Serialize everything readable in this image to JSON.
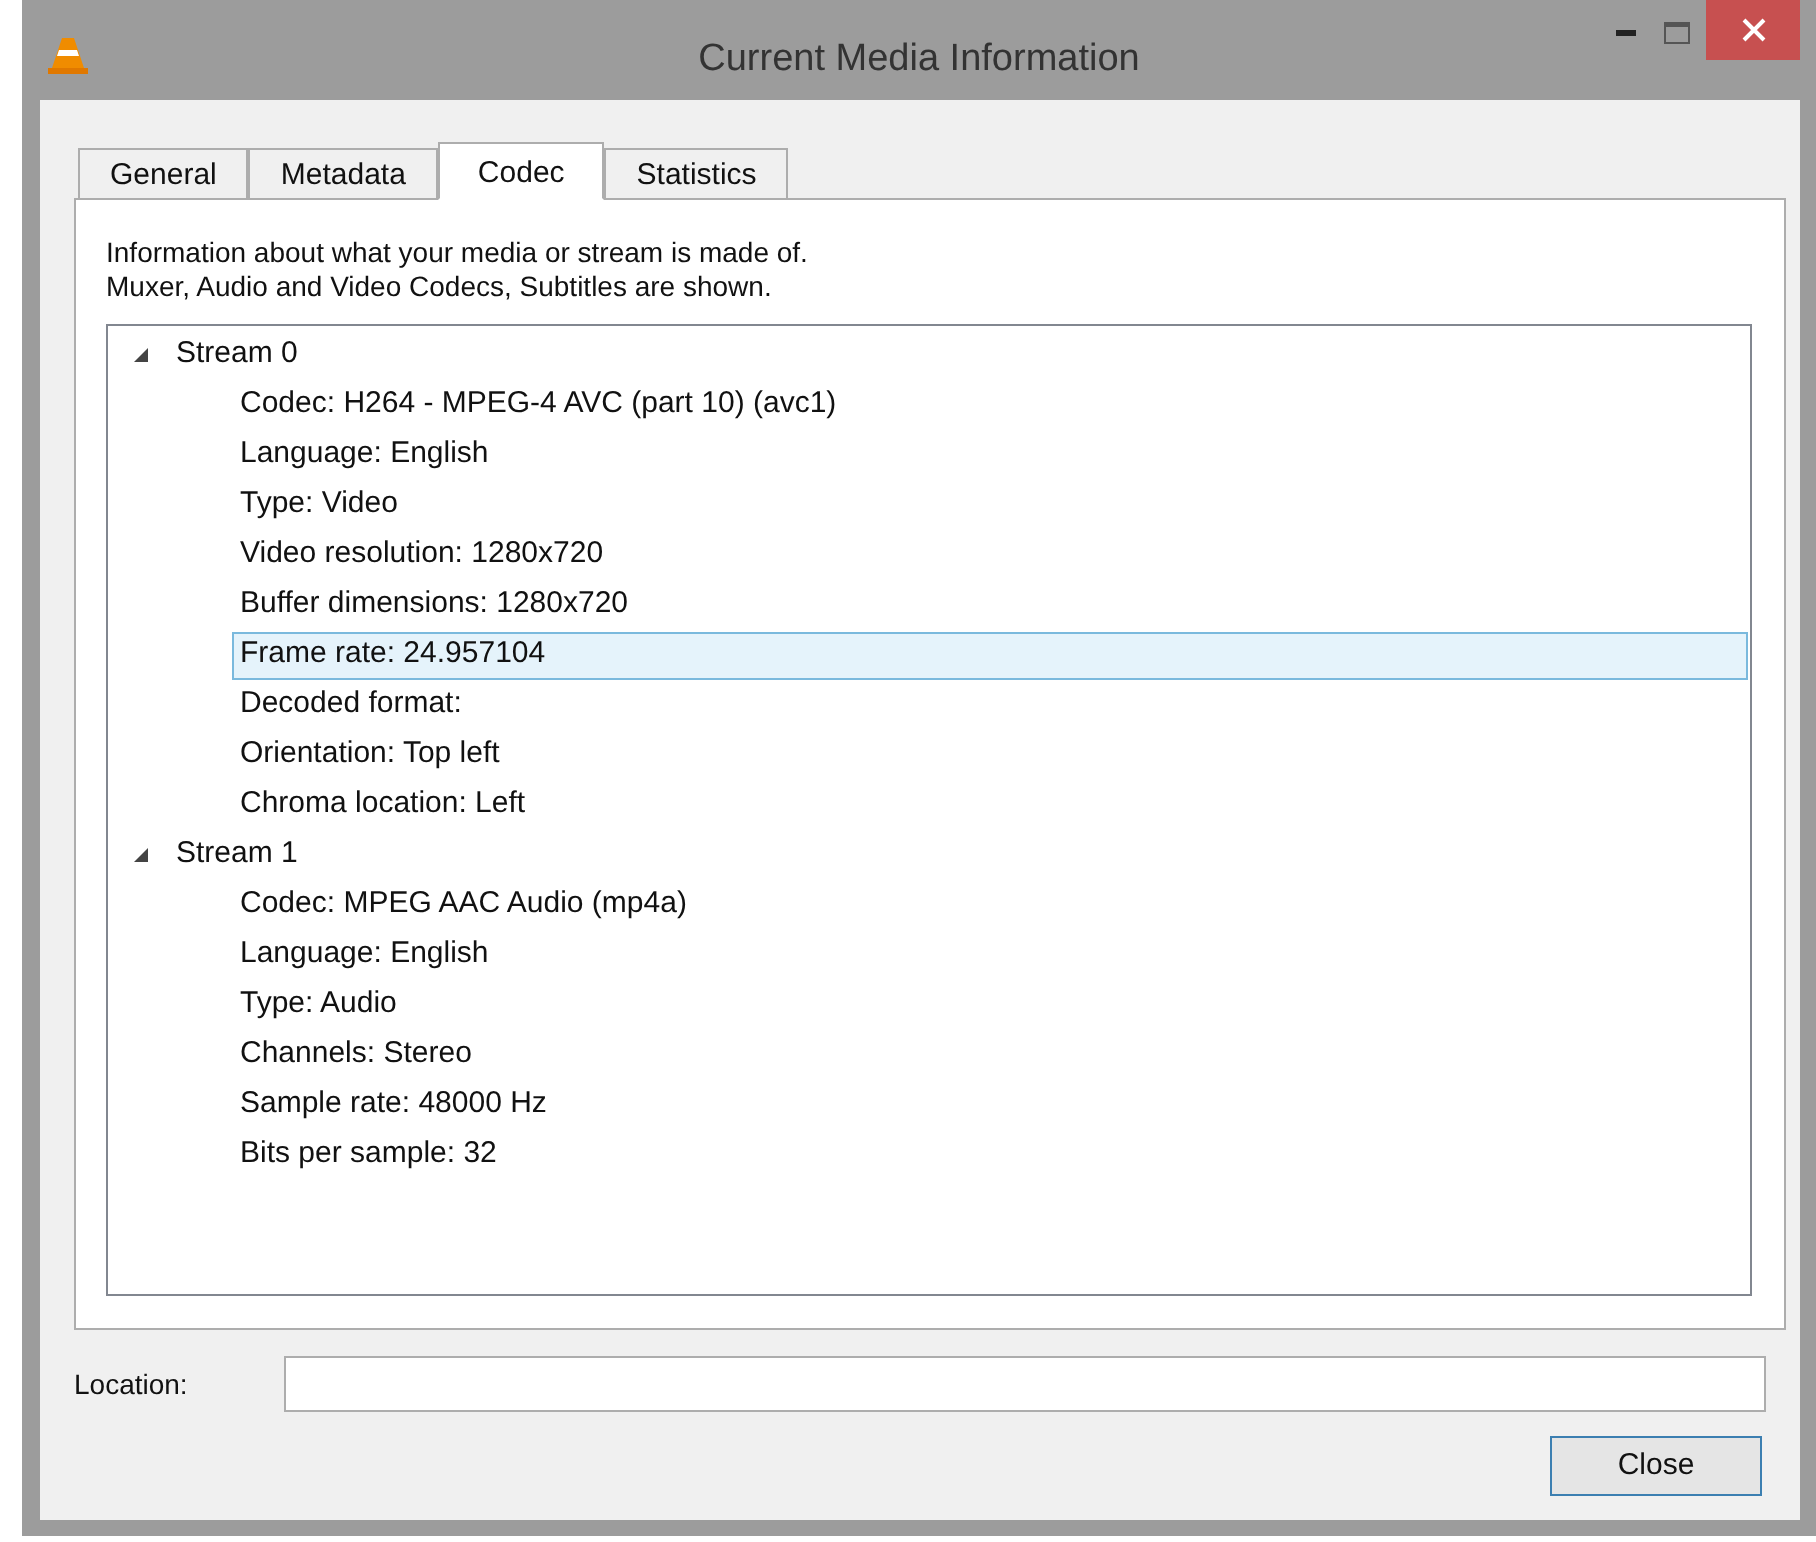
{
  "window": {
    "title": "Current Media Information"
  },
  "tabs": [
    {
      "label": "General",
      "selected": false
    },
    {
      "label": "Metadata",
      "selected": false
    },
    {
      "label": "Codec",
      "selected": true
    },
    {
      "label": "Statistics",
      "selected": false
    }
  ],
  "description": [
    "Information about what your media or stream is made of.",
    "Muxer, Audio and Video Codecs, Subtitles are shown."
  ],
  "tree": [
    {
      "label": "Stream 0",
      "expanded": true,
      "children": [
        {
          "label": "Codec: H264 - MPEG-4 AVC (part 10) (avc1)",
          "selected": false
        },
        {
          "label": "Language: English",
          "selected": false
        },
        {
          "label": "Type: Video",
          "selected": false
        },
        {
          "label": "Video resolution: 1280x720",
          "selected": false
        },
        {
          "label": "Buffer dimensions: 1280x720",
          "selected": false
        },
        {
          "label": "Frame rate: 24.957104",
          "selected": true
        },
        {
          "label": "Decoded format:",
          "selected": false
        },
        {
          "label": "Orientation: Top left",
          "selected": false
        },
        {
          "label": "Chroma location: Left",
          "selected": false
        }
      ]
    },
    {
      "label": "Stream 1",
      "expanded": true,
      "children": [
        {
          "label": "Codec: MPEG AAC Audio (mp4a)",
          "selected": false
        },
        {
          "label": "Language: English",
          "selected": false
        },
        {
          "label": "Type: Audio",
          "selected": false
        },
        {
          "label": "Channels: Stereo",
          "selected": false
        },
        {
          "label": "Sample rate: 48000 Hz",
          "selected": false
        },
        {
          "label": "Bits per sample: 32",
          "selected": false
        }
      ]
    }
  ],
  "location": {
    "label": "Location:"
  },
  "buttons": [
    "Close"
  ]
}
